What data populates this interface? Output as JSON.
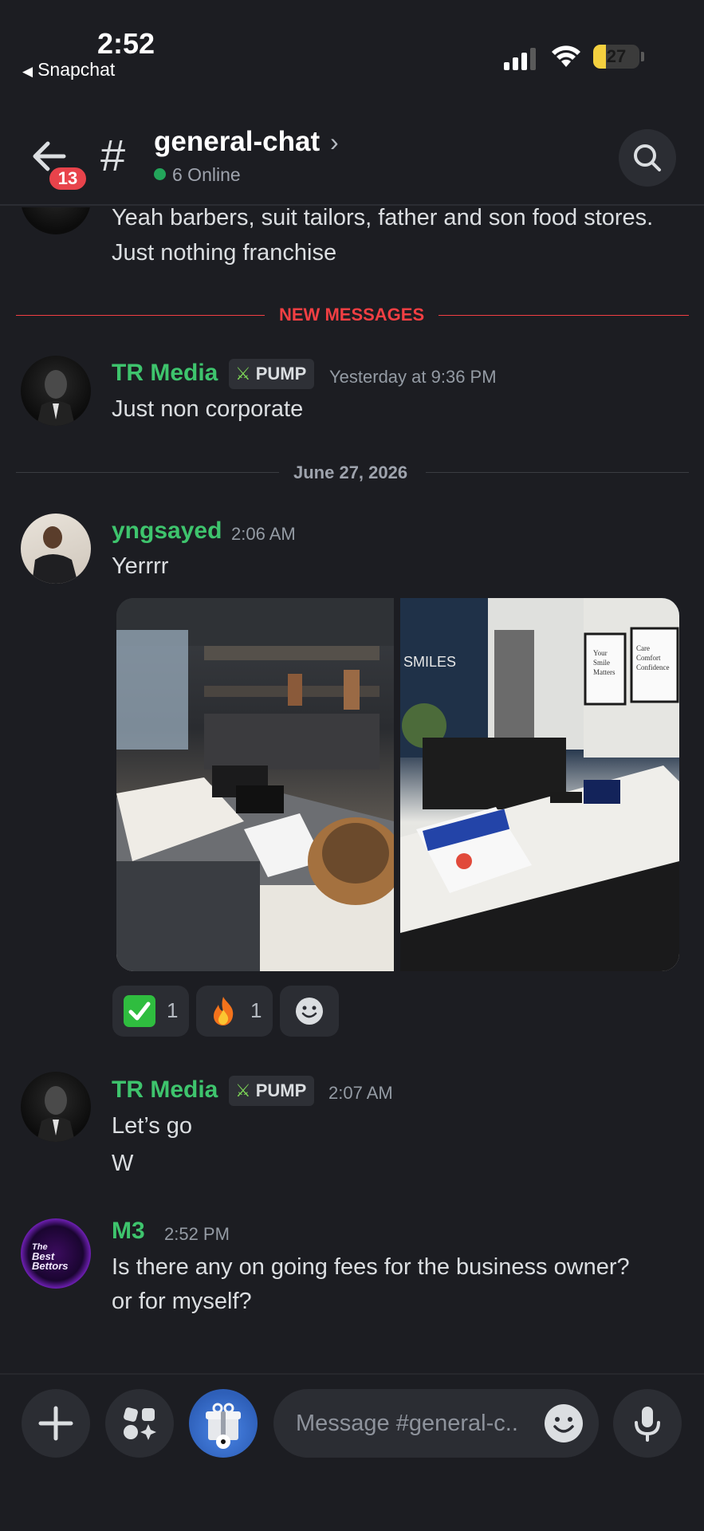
{
  "status_bar": {
    "time": "2:52",
    "back_app": "Snapchat",
    "battery": "27",
    "battery_level": 0.27,
    "signal_bars": 3
  },
  "header": {
    "unread_badge": "13",
    "channel_name": "general-chat",
    "online_text": "6 Online",
    "icons": {
      "back": "arrow-left-icon",
      "channel": "hash-icon",
      "chevron": "chevron-right-icon",
      "search": "search-icon"
    }
  },
  "messages": {
    "prev_text": "Yeah barbers, suit tailors, father and son food stores. Just nothing franchise",
    "new_messages_label": "NEW MESSAGES",
    "m1": {
      "author": "TR Media",
      "role": "PUMP",
      "time": "Yesterday at 9:36 PM",
      "text": "Just non corporate"
    },
    "date_separator": "June 27, 2026",
    "m2": {
      "author": "yngsayed",
      "time": "2:06 AM",
      "text": "Yerrrr",
      "reactions": [
        {
          "emoji": "check-mark-icon",
          "count": "1"
        },
        {
          "emoji": "fire-icon",
          "count": "1"
        }
      ],
      "add_reaction_icon": "smiley-icon",
      "photo_text": {
        "right_sign": "SMILES",
        "frame1": [
          "Your",
          "Smile",
          "Matters"
        ],
        "frame2": [
          "Care",
          "Comfort",
          "Confidence"
        ]
      }
    },
    "m3": {
      "author": "TR Media",
      "role": "PUMP",
      "time": "2:07 AM",
      "line1": "Let’s go",
      "line2": "W"
    },
    "m4": {
      "author": "M3",
      "time": "2:52 PM",
      "line1": "Is there any on going fees for the business owner?",
      "line2": "or for myself?",
      "avatar_text": [
        "The",
        "Best",
        "Bettors"
      ]
    }
  },
  "composer": {
    "placeholder": "Message #general-c..",
    "icons": {
      "add": "plus-icon",
      "apps": "apps-icon",
      "gift": "gift-icon",
      "emoji": "smiley-icon",
      "voice": "microphone-icon"
    }
  },
  "colors": {
    "background": "#1c1d22",
    "author_green": "#3ec46d",
    "new_messages_red": "#f23f43",
    "online_green": "#23a55a"
  }
}
